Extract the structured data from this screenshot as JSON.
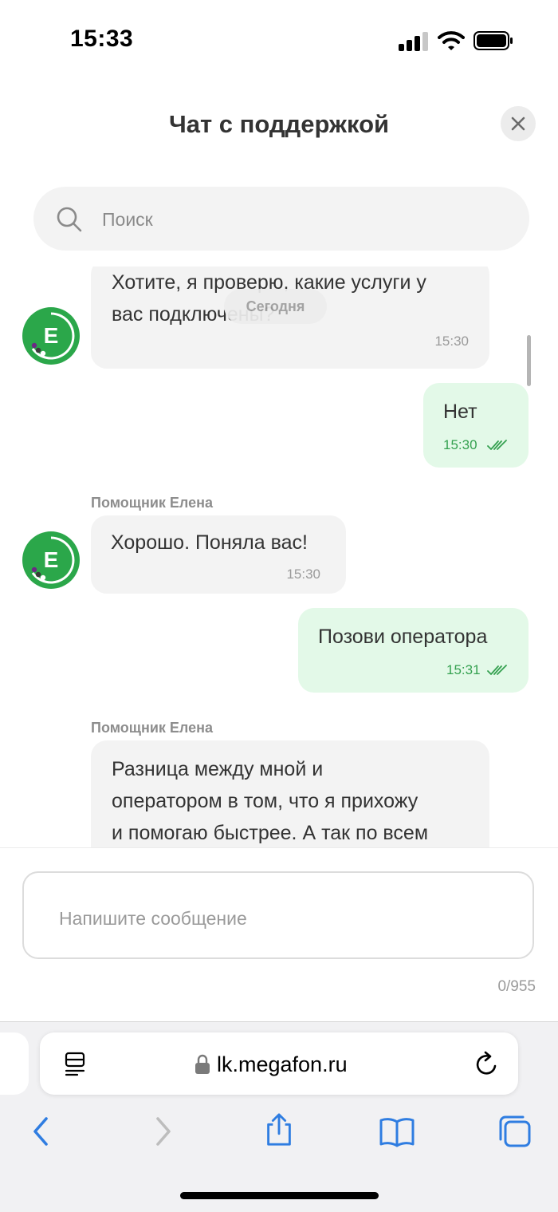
{
  "status_bar": {
    "time": "15:33"
  },
  "header": {
    "title": "Чат с поддержкой"
  },
  "search": {
    "placeholder": "Поиск"
  },
  "chat": {
    "date_chip": "Сегодня",
    "messages": [
      {
        "from": "assistant",
        "text_lines": [
          "Хотите, я проверю, какие услуги у",
          "вас подключены?"
        ],
        "time": "15:30"
      },
      {
        "from": "user",
        "text": "Нет",
        "time": "15:30"
      },
      {
        "from": "assistant",
        "sender": "Помощник Елена",
        "text": "Хорошо. Поняла вас!",
        "time": "15:30"
      },
      {
        "from": "user",
        "text": "Позови оператора",
        "time": "15:31"
      },
      {
        "from": "assistant",
        "sender": "Помощник Елена",
        "text_lines": [
          "Разница между мной и",
          "оператором в том, что я прихожу",
          "и помогаю быстрее. А так по всем"
        ]
      }
    ],
    "avatar_letter": "Е"
  },
  "composer": {
    "placeholder": "Напишите сообщение",
    "counter": "0/955"
  },
  "browser": {
    "url": "lk.megafon.ru"
  },
  "colors": {
    "accent_green": "#2ba74a",
    "outgoing_bubble": "#e3f9e8",
    "incoming_bubble": "#f3f3f3",
    "ios_blue": "#2f7de1"
  },
  "icons": [
    "signal-icon",
    "wifi-icon",
    "battery-icon",
    "close-icon",
    "search-icon",
    "double-check-icon",
    "reader-icon",
    "lock-icon",
    "reload-icon",
    "back-icon",
    "forward-icon",
    "share-icon",
    "bookmarks-icon",
    "tabs-icon"
  ]
}
